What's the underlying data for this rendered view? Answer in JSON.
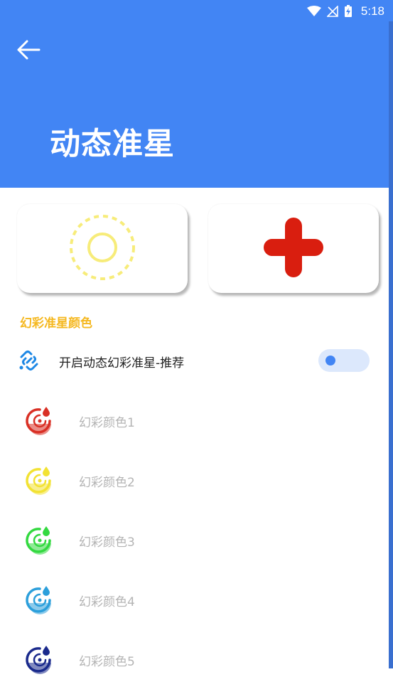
{
  "status_bar": {
    "time": "5:18",
    "icons": [
      "wifi-icon",
      "no-signal-icon",
      "battery-charging-icon"
    ]
  },
  "header": {
    "back_icon": "arrow-left-icon",
    "title": "动态准星",
    "background_color": "#4285F4"
  },
  "previews": [
    {
      "name": "circle-crosshair-preview",
      "icon": "dashed-circle-crosshair-icon",
      "color": "#F7EC7A"
    },
    {
      "name": "cross-crosshair-preview",
      "icon": "plus-crosshair-icon",
      "color": "#D91E0F"
    }
  ],
  "section": {
    "title": "幻彩准星颜色",
    "title_color": "#F5B820"
  },
  "toggle": {
    "icon": "rainbow-link-icon",
    "label": "开启动态幻彩准星-推荐",
    "on": false
  },
  "colors": [
    {
      "label": "幻彩颜色1",
      "icon": "target-drop-icon",
      "color": "#D93025"
    },
    {
      "label": "幻彩颜色2",
      "icon": "target-drop-icon",
      "color": "#F2E233"
    },
    {
      "label": "幻彩颜色3",
      "icon": "target-drop-icon",
      "color": "#33D940"
    },
    {
      "label": "幻彩颜色4",
      "icon": "target-drop-icon",
      "color": "#2C9FDB"
    },
    {
      "label": "幻彩颜色5",
      "icon": "target-drop-icon",
      "color": "#1A2A8C"
    }
  ]
}
